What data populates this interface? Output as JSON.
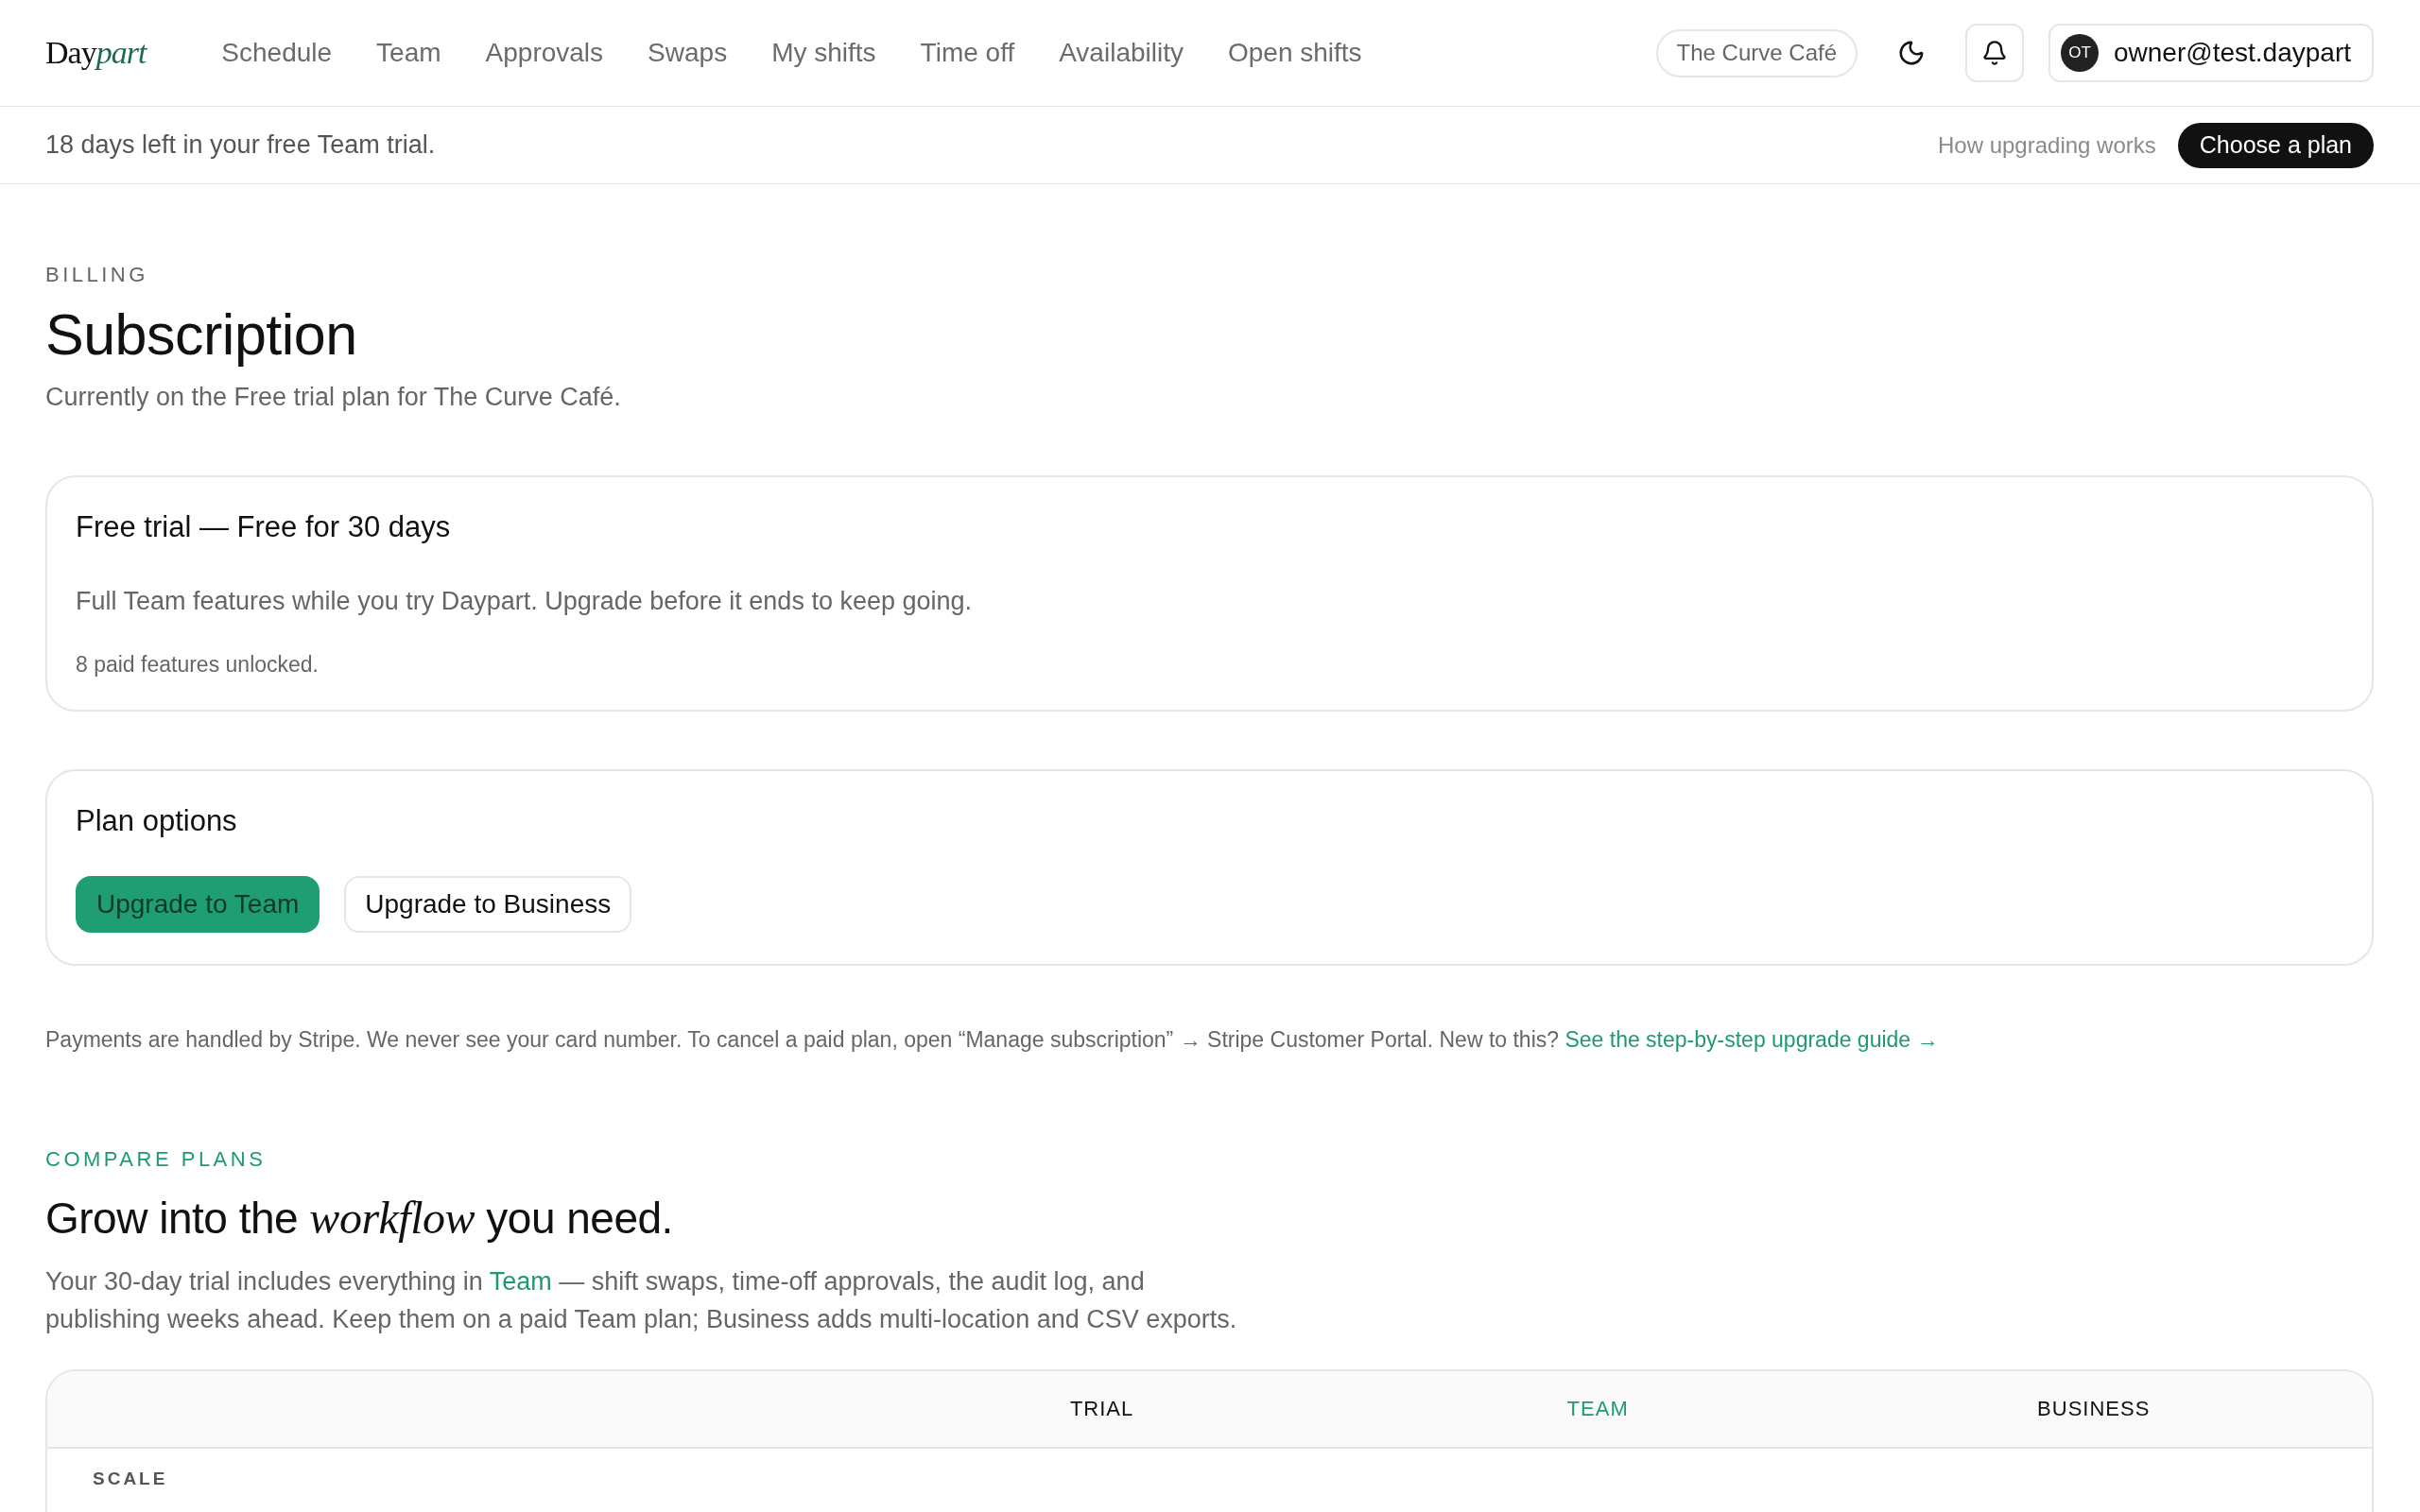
{
  "header": {
    "logo": {
      "text": "Day",
      "accent": "part"
    },
    "nav": [
      {
        "label": "Schedule",
        "selected": false
      },
      {
        "label": "Team",
        "selected": false
      },
      {
        "label": "Approvals",
        "selected": false
      },
      {
        "label": "Swaps",
        "selected": false
      },
      {
        "label": "My shifts",
        "selected": false
      },
      {
        "label": "Time off",
        "selected": false
      },
      {
        "label": "Availability",
        "selected": false
      },
      {
        "label": "Open shifts",
        "selected": false
      }
    ],
    "location": "The Curve Café",
    "user": {
      "initials": "OT",
      "email": "owner@test.daypart"
    }
  },
  "trial_bar": {
    "message": "18 days left in your free Team trial.",
    "help_link": "How upgrading works",
    "cta": "Choose a plan"
  },
  "page": {
    "eyebrow": "BILLING",
    "title": "Subscription",
    "subtitle": "Currently on the Free trial plan for The Curve Café."
  },
  "current_plan": {
    "title": "Free trial — Free for 30 days",
    "description": "Full Team features while you try Daypart. Upgrade before it ends to keep going.",
    "note": "8 paid features unlocked."
  },
  "plan_options": {
    "title": "Plan options",
    "buttons": [
      {
        "label": "Upgrade to Team",
        "kind": "primary"
      },
      {
        "label": "Upgrade to Business",
        "kind": "secondary"
      }
    ]
  },
  "payments_note": {
    "text": "Payments are handled by Stripe. We never see your card number. To cancel a paid plan, open “Manage subscription” → Stripe Customer Portal. New to this? ",
    "link": "See the step-by-step upgrade guide →"
  },
  "compare": {
    "eyebrow": "COMPARE PLANS",
    "title": "Grow into the *workflow* you need.",
    "intro": {
      "before": "Your 30-day trial includes everything in ",
      "link": "Team",
      "after": " — shift swaps, time-off approvals, the audit log, and publishing weeks ahead. Keep them on a paid Team plan; Business adds multi-location and CSV exports."
    }
  },
  "table": {
    "columns": [
      {
        "label": "TRIAL",
        "highlighted": false
      },
      {
        "label": "TEAM",
        "highlighted": true
      },
      {
        "label": "BUSINESS",
        "highlighted": false
      }
    ],
    "sections": [
      {
        "label": "SCALE"
      }
    ]
  }
}
